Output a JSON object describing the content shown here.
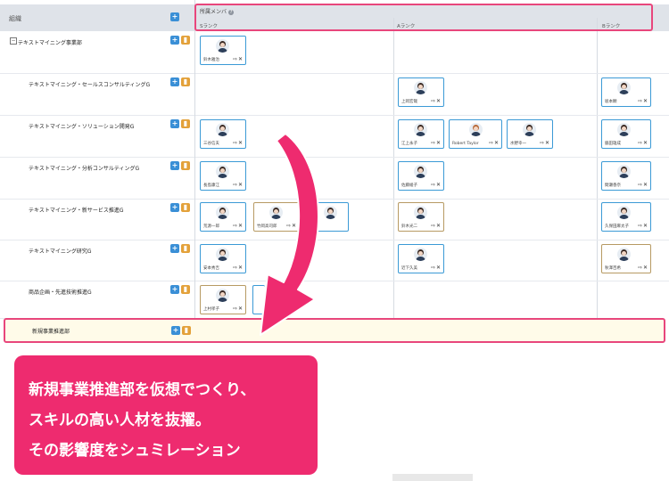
{
  "org_column": {
    "title": "組織"
  },
  "grid_header": {
    "title": "所属メンバ",
    "help": "?",
    "ranks": [
      "Sランク",
      "Aランク",
      "Bランク"
    ]
  },
  "orgs": [
    {
      "name": "テキストマイニング事業部",
      "toggle": "−"
    },
    {
      "name": "テキストマイニング・セールスコンサルティングG"
    },
    {
      "name": "テキストマイニング・ソリューション開発G"
    },
    {
      "name": "テキストマイニング・分析コンサルティングG"
    },
    {
      "name": "テキストマイニング・新サービス推進G"
    },
    {
      "name": "テキストマイニング研究G"
    },
    {
      "name": "商品企画・先進技術推進G"
    },
    {
      "name": "新規事業推進部"
    }
  ],
  "members": [
    {
      "name": "鈴木雅治",
      "rank": "S",
      "row": 0
    },
    {
      "name": "上岡宏哉",
      "rank": "A",
      "row": 1
    },
    {
      "name": "坂本顕",
      "rank": "B",
      "row": 1
    },
    {
      "name": "三谷信夫",
      "rank": "S",
      "row": 2
    },
    {
      "name": "江上永子",
      "rank": "A",
      "row": 2
    },
    {
      "name": "Robert Taylor",
      "rank": "A",
      "row": 2
    },
    {
      "name": "水野幸一",
      "rank": "A",
      "row": 2
    },
    {
      "name": "脇田雄成",
      "rank": "B",
      "row": 2
    },
    {
      "name": "長島康江",
      "rank": "S",
      "row": 3
    },
    {
      "name": "佐藤綾子",
      "rank": "A",
      "row": 3
    },
    {
      "name": "間瀬香奈",
      "rank": "B",
      "row": 3
    },
    {
      "name": "荒源一郎",
      "rank": "S",
      "row": 4
    },
    {
      "name": "竹岡高司郎",
      "rank": "S",
      "row": 4
    },
    {
      "name": "鈴木光二",
      "rank": "A",
      "row": 4
    },
    {
      "name": "久保田麻太子",
      "rank": "B",
      "row": 4
    },
    {
      "name": "安本秀吉",
      "rank": "S",
      "row": 5
    },
    {
      "name": "近下久美",
      "rank": "A",
      "row": 5
    },
    {
      "name": "秋澤百希",
      "rank": "B",
      "row": 5
    },
    {
      "name": "上村孝子",
      "rank": "S",
      "row": 6
    }
  ],
  "card_actions": {
    "move": "⇨",
    "remove": "✕"
  },
  "callout": {
    "lines": [
      "新規事業推進部を仮想でつくり、",
      "スキルの高い人材を抜擢。",
      "その影響度をシュミレーション"
    ]
  },
  "colors": {
    "accent": "#ee2b6f",
    "highlight_border": "#e8467c",
    "card_blue": "#3b9ad6",
    "card_gold": "#b79a63",
    "btn_plus": "#3a8fd6",
    "btn_trash": "#e3a13a"
  }
}
